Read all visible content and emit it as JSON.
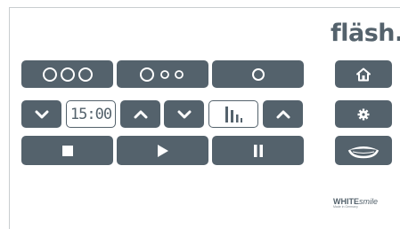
{
  "brand": {
    "logo": "fläsh.",
    "maker": "WHITE",
    "maker_italic": "smile",
    "maker_sub": "Made in Germany"
  },
  "timer": {
    "value": "15:00"
  },
  "colors": {
    "button": "#54626c",
    "background": "#ffffff",
    "text": "#ffffff"
  },
  "buttons": {
    "intensity_high": "three-large-circles-icon",
    "intensity_medium": "one-large-two-small-circles-icon",
    "intensity_low": "one-circle-icon",
    "time_down": "chevron-down-icon",
    "time_up": "chevron-up-icon",
    "level_down": "chevron-down-icon",
    "level_up": "chevron-up-icon",
    "stop": "stop-icon",
    "play": "play-icon",
    "pause": "pause-icon",
    "home": "home-icon",
    "settings": "gear-icon",
    "tray": "tray-icon"
  }
}
